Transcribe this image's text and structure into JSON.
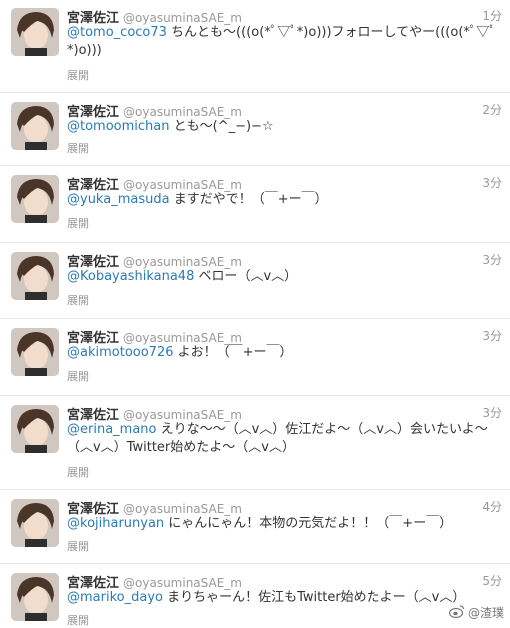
{
  "author": {
    "name": "宮澤佐江",
    "handle": "@oyasuminaSAE_m"
  },
  "tweets": [
    {
      "time": "1分",
      "mention": "@tomo_coco73",
      "text": " ちんとも～(((o(*ﾟ▽ﾟ*)o)))フォローしてやー(((o(*ﾟ▽ﾟ*)o)))",
      "expand": "展開"
    },
    {
      "time": "2分",
      "mention": "@tomoomichan",
      "text": " とも～(^_−)−☆",
      "expand": "展開"
    },
    {
      "time": "3分",
      "mention": "@yuka_masuda",
      "text": " ますだやで！（￣+ー￣）",
      "expand": "展開"
    },
    {
      "time": "3分",
      "mention": "@Kobayashikana48",
      "text": " ベロー（︿v︿）",
      "expand": "展開"
    },
    {
      "time": "3分",
      "mention": "@akimotooo726",
      "text": " よお！（￣+ー￣）",
      "expand": "展開"
    },
    {
      "time": "3分",
      "mention": "@erina_mano",
      "text": " えりな～～（︿v︿）佐江だよ～（︿v︿）会いたいよ～（︿v︿）Twitter始めたよ～（︿v︿）",
      "expand": "展開"
    },
    {
      "time": "4分",
      "mention": "@kojiharunyan",
      "text": " にゃんにゃん！本物の元気だよ！！（￣+ー￣）",
      "expand": "展開"
    },
    {
      "time": "5分",
      "mention": "@mariko_dayo",
      "text": " まりちゃーん！佐江もTwitter始めたよー（︿v︿）",
      "expand": "展開"
    }
  ],
  "watermark": {
    "text": "@渣璞"
  }
}
